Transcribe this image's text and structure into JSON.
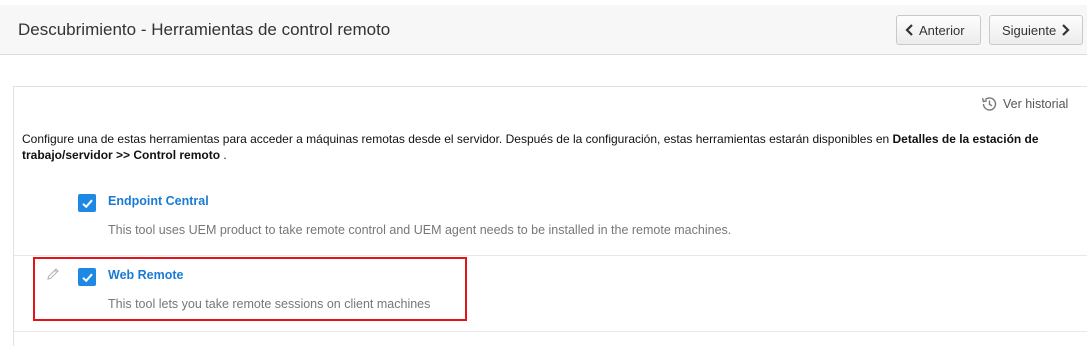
{
  "header": {
    "title": "Descubrimiento - Herramientas de control remoto",
    "prev_label": "Anterior",
    "next_label": "Siguiente"
  },
  "history": {
    "label": "Ver historial"
  },
  "description": {
    "text": "Configure una de estas herramientas para acceder a máquinas remotas desde el servidor. Después de la configuración, estas herramientas estarán disponibles en ",
    "bold": "Detalles de la estación de trabajo/servidor >> Control remoto",
    "suffix": " ."
  },
  "tools": [
    {
      "name": "Endpoint Central",
      "description": "This tool uses UEM product to take remote control and UEM agent needs to be installed in the remote machines.",
      "checked": true
    },
    {
      "name": "Web Remote",
      "description": "This tool lets you take remote sessions on client machines",
      "checked": true
    }
  ],
  "colors": {
    "accent": "#1e88e5",
    "link": "#1a7bd4",
    "highlight": "#e0141b"
  }
}
